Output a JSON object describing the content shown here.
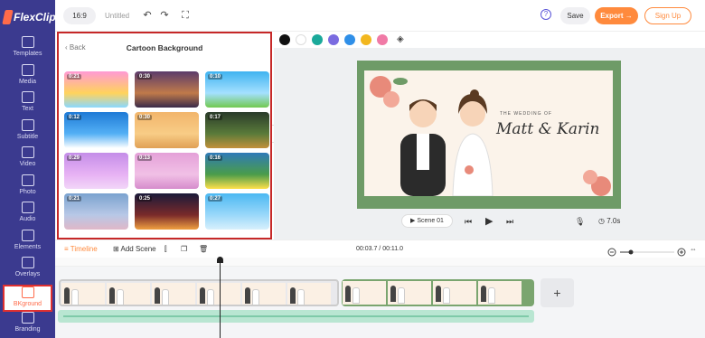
{
  "app": {
    "logo": "FlexClip"
  },
  "sidebar": {
    "items": [
      {
        "label": "Templates",
        "icon": "templates-icon"
      },
      {
        "label": "Media",
        "icon": "media-icon"
      },
      {
        "label": "Text",
        "icon": "text-icon"
      },
      {
        "label": "Subtitle",
        "icon": "subtitle-icon"
      },
      {
        "label": "Video",
        "icon": "video-icon"
      },
      {
        "label": "Photo",
        "icon": "photo-icon"
      },
      {
        "label": "Audio",
        "icon": "audio-icon"
      },
      {
        "label": "Elements",
        "icon": "elements-icon"
      },
      {
        "label": "Overlays",
        "icon": "overlays-icon"
      },
      {
        "label": "BKground",
        "icon": "background-icon",
        "active": true
      },
      {
        "label": "Branding",
        "icon": "branding-icon"
      }
    ]
  },
  "toolbar": {
    "ratio": "16:9",
    "title": "Untitled",
    "help": "?",
    "save_label": "Save",
    "export_label": "Export →",
    "signup_label": "Sign Up"
  },
  "panel": {
    "back_label": "Back",
    "title": "Cartoon Background",
    "thumbs": [
      {
        "duration": "0:21",
        "colors": [
          "#ff9ad5",
          "#ffd35c",
          "#8ad8ff"
        ]
      },
      {
        "duration": "0:30",
        "colors": [
          "#5b3b6b",
          "#c07a4a",
          "#3a2b4a"
        ]
      },
      {
        "duration": "0:10",
        "colors": [
          "#3fb3f0",
          "#a4e0ff",
          "#71c94f"
        ]
      },
      {
        "duration": "0:12",
        "colors": [
          "#1e7ad6",
          "#54b0f5",
          "#ffffff"
        ]
      },
      {
        "duration": "0:30",
        "colors": [
          "#f2b56b",
          "#f8cc86",
          "#e0a055"
        ]
      },
      {
        "duration": "0:17",
        "colors": [
          "#2a3b2a",
          "#5a7b3a",
          "#c2903a"
        ]
      },
      {
        "duration": "0:29",
        "colors": [
          "#c48de8",
          "#e7b2f4",
          "#f2d6f8"
        ]
      },
      {
        "duration": "0:13",
        "colors": [
          "#e4a0d8",
          "#f1c0e6",
          "#d68ccc"
        ]
      },
      {
        "duration": "0:16",
        "colors": [
          "#2f7ab8",
          "#4a9c4a",
          "#ffe04a"
        ]
      },
      {
        "duration": "0:21",
        "colors": [
          "#7aa2cf",
          "#b8c8e6",
          "#e0b8c8"
        ]
      },
      {
        "duration": "0:25",
        "colors": [
          "#1a1a3a",
          "#7a2a2a",
          "#f0a040"
        ]
      },
      {
        "duration": "0:27",
        "colors": [
          "#4cb8f2",
          "#9ad8fa",
          "#d8f0fc"
        ]
      }
    ]
  },
  "colors": [
    "#111111",
    "#ffffff",
    "#1aa99a",
    "#7a6be0",
    "#2f8fe8",
    "#f2b71f",
    "#f07aa6"
  ],
  "canvas": {
    "wedding_text": "THE WEDDING OF",
    "names": "Matt & Karin",
    "scene_label": "Scene 01",
    "duration": "7.0s"
  },
  "timeline": {
    "timeline_label": "Timeline",
    "add_scene_label": "Add Scene",
    "timecode": "00:03.7 / 00:11.0",
    "zoom_level": 0.2,
    "add_button": "+"
  }
}
